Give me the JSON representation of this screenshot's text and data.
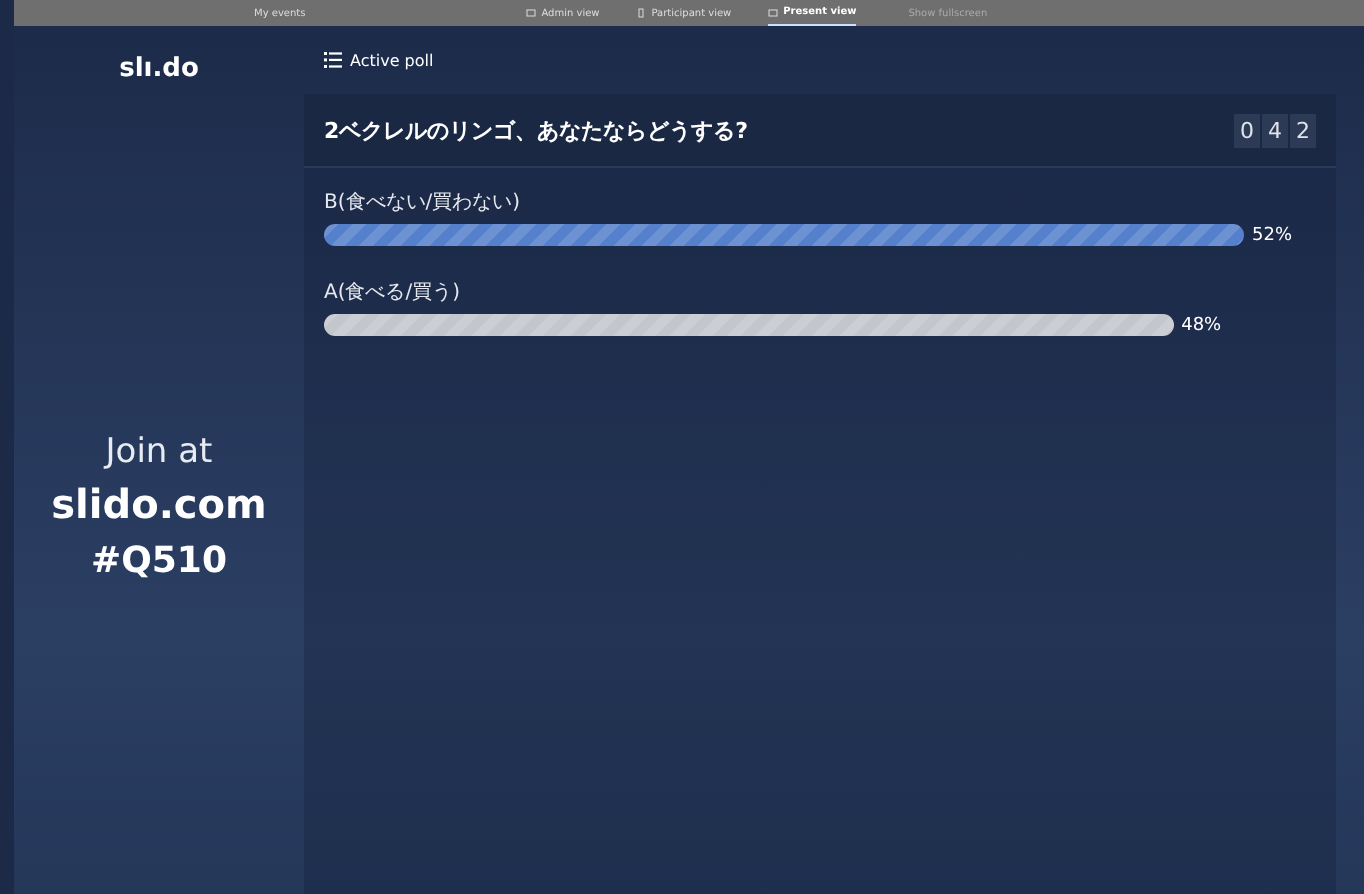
{
  "top_bar": {
    "back_link": "My events",
    "views": [
      {
        "label": "Admin view",
        "selected": false,
        "kind": "monitor"
      },
      {
        "label": "Participant view",
        "selected": false,
        "kind": "phone"
      },
      {
        "label": "Present view",
        "selected": true,
        "kind": "monitor"
      }
    ],
    "extra_link": "Show fullscreen"
  },
  "sidebar": {
    "logo": "slı.do",
    "join_text": "Join at",
    "site": "slido.com",
    "event_code": "#Q510"
  },
  "section_title": "Active poll",
  "poll": {
    "question": "2ベクレルのリンゴ、あなたならどうする?",
    "vote_digits": [
      "0",
      "4",
      "2"
    ],
    "options": [
      {
        "label": "B(食べない/買わない)",
        "percent": "52%",
        "selected": true
      },
      {
        "label": "A(食べる/買う)",
        "percent": "48%",
        "selected": false
      }
    ]
  }
}
